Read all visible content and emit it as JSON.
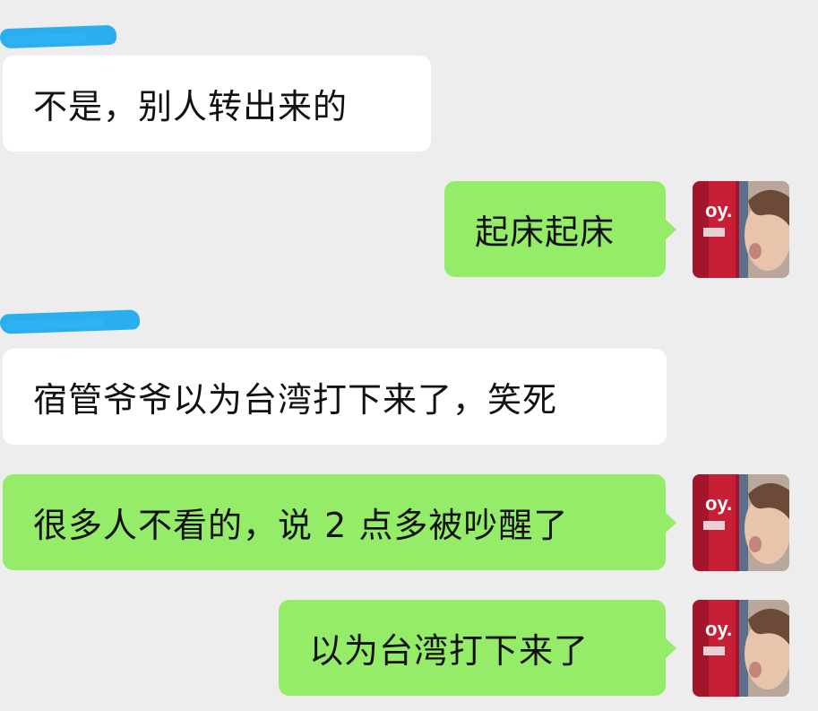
{
  "messages": [
    {
      "side": "left",
      "text": "不是，别人转出来的"
    },
    {
      "side": "right",
      "text": "起床起床"
    },
    {
      "side": "left",
      "text": "宿管爷爷以为台湾打下来了，笑死"
    },
    {
      "side": "right",
      "text": "很多人不看的，说 2 点多被吵醒了"
    },
    {
      "side": "right",
      "text": "以为台湾打下来了"
    }
  ],
  "colors": {
    "background": "#ededed",
    "incoming_bubble": "#ffffff",
    "outgoing_bubble": "#95ec69",
    "name_redaction": "#29aef0"
  },
  "icons": {
    "avatar": "user-avatar-photo"
  }
}
